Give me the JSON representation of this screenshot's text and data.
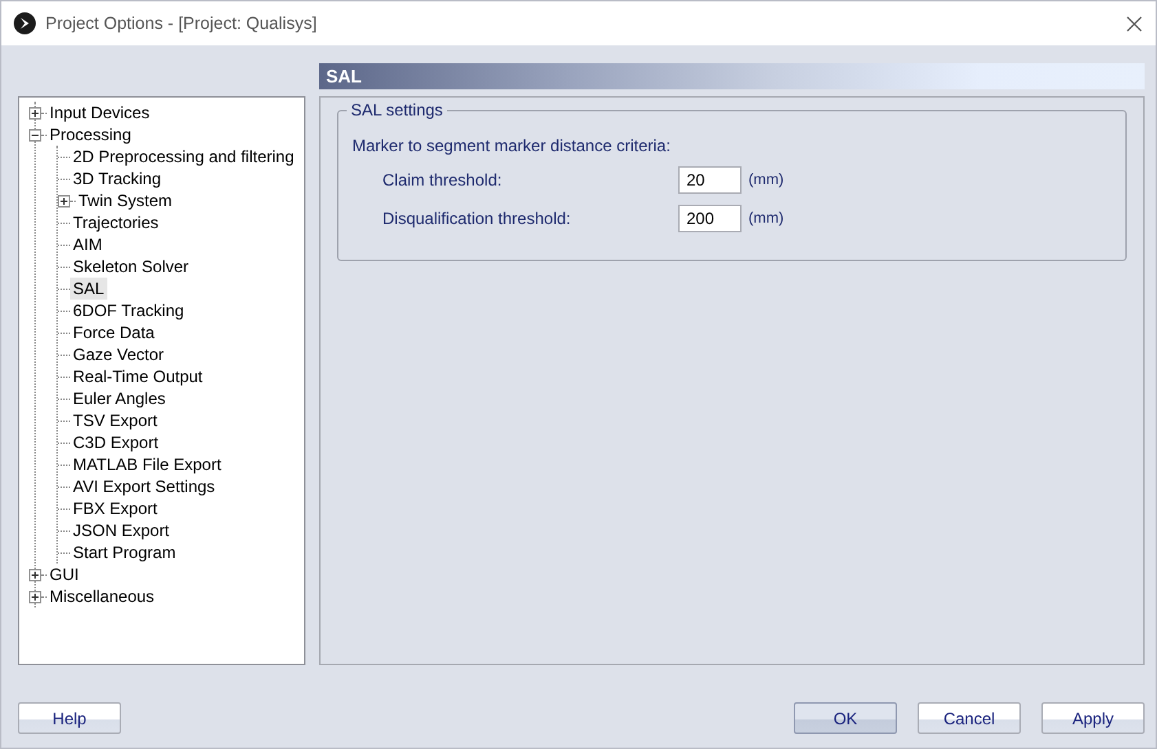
{
  "window": {
    "title": "Project Options - [Project: Qualisys]"
  },
  "tree": [
    {
      "label": "Input Devices",
      "expanded": false,
      "selected": false
    },
    {
      "label": "Processing",
      "expanded": true,
      "selected": false,
      "children": [
        {
          "label": "2D Preprocessing and filtering",
          "selected": false
        },
        {
          "label": "3D Tracking",
          "selected": false
        },
        {
          "label": "Twin System",
          "expanded": false,
          "selected": false
        },
        {
          "label": "Trajectories",
          "selected": false
        },
        {
          "label": "AIM",
          "selected": false
        },
        {
          "label": "Skeleton Solver",
          "selected": false
        },
        {
          "label": "SAL",
          "selected": true
        },
        {
          "label": "6DOF Tracking",
          "selected": false
        },
        {
          "label": "Force Data",
          "selected": false
        },
        {
          "label": "Gaze Vector",
          "selected": false
        },
        {
          "label": "Real-Time Output",
          "selected": false
        },
        {
          "label": "Euler Angles",
          "selected": false
        },
        {
          "label": "TSV Export",
          "selected": false
        },
        {
          "label": "C3D Export",
          "selected": false
        },
        {
          "label": "MATLAB File Export",
          "selected": false
        },
        {
          "label": "AVI Export Settings",
          "selected": false
        },
        {
          "label": "FBX Export",
          "selected": false
        },
        {
          "label": "JSON Export",
          "selected": false
        },
        {
          "label": "Start Program",
          "selected": false
        }
      ]
    },
    {
      "label": "GUI",
      "expanded": false,
      "selected": false
    },
    {
      "label": "Miscellaneous",
      "expanded": false,
      "selected": false
    }
  ],
  "page": {
    "header": "SAL",
    "group": {
      "title": "SAL settings",
      "caption": "Marker to segment marker distance criteria:",
      "fields": [
        {
          "label": "Claim threshold:",
          "value": "20",
          "unit": "(mm)"
        },
        {
          "label": "Disqualification threshold:",
          "value": "200",
          "unit": "(mm)"
        }
      ]
    }
  },
  "buttons": {
    "left": [
      {
        "label": "Help",
        "default": false
      }
    ],
    "right": [
      {
        "label": "OK",
        "default": true
      },
      {
        "label": "Cancel",
        "default": false
      },
      {
        "label": "Apply",
        "default": false
      }
    ]
  }
}
